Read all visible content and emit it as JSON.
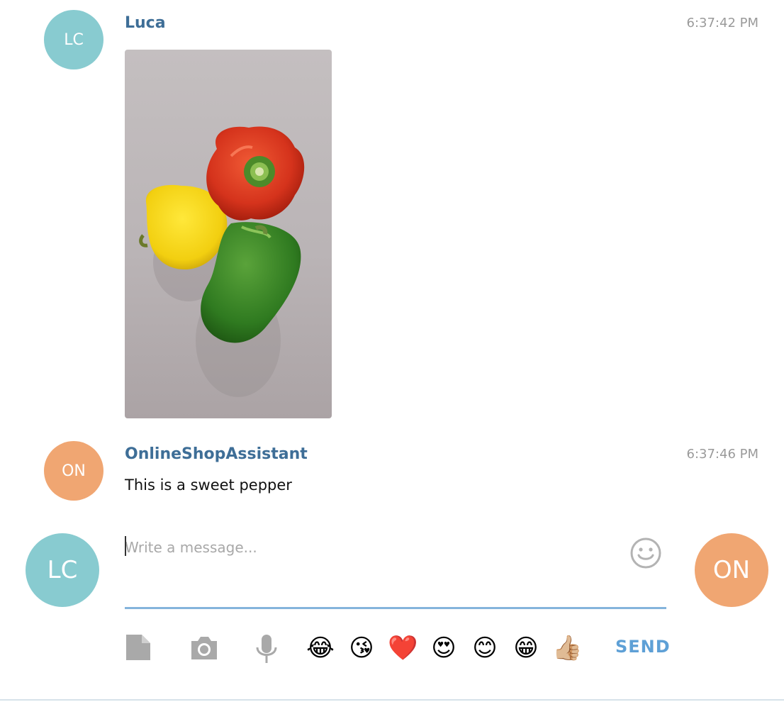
{
  "messages": [
    {
      "avatar_initials": "LC",
      "sender": "Luca",
      "time": "6:37:42 PM",
      "content_type": "image",
      "image_subject": "three bell peppers: red, yellow and green"
    },
    {
      "avatar_initials": "ON",
      "sender": "OnlineShopAssistant",
      "time": "6:37:46 PM",
      "content_type": "text",
      "text": "This is a sweet pepper"
    }
  ],
  "composer": {
    "left_avatar_initials": "LC",
    "right_avatar_initials": "ON",
    "placeholder": "Write a message...",
    "value": "",
    "send_label": "SEND",
    "tools": [
      "file-icon",
      "camera-icon",
      "microphone-icon"
    ],
    "quick_emojis": [
      "😂",
      "😘",
      "❤️",
      "😍",
      "😊",
      "😁",
      "👍🏼"
    ]
  },
  "colors": {
    "sender_name": "#3e6e97",
    "timestamp": "#9a9a9a",
    "avatar_teal": "#88cbd0",
    "avatar_orange": "#f0a672",
    "send": "#5ea0d6",
    "input_underline": "#84b4dc"
  }
}
